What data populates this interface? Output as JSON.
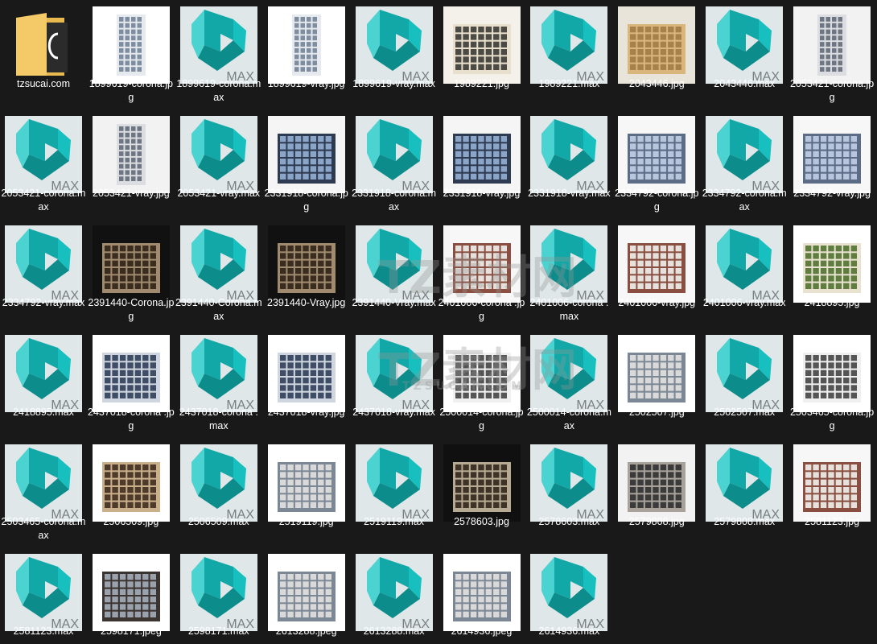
{
  "window": {
    "background": "#191919",
    "text_color": "#ffffff"
  },
  "icons": {
    "max": {
      "name": "3ds-max-file-icon",
      "badge": "MAX",
      "teal": "#11a8a7",
      "bg": "#dfe7e9"
    },
    "folder": {
      "name": "folder-icon",
      "color": "#f4c967"
    },
    "image": {
      "name": "image-thumbnail-icon"
    }
  },
  "watermark": {
    "main": "TZ素材网",
    "sub": "TZSUCAI.COM"
  },
  "files": [
    {
      "name": "tzsucai.com",
      "type": "folder"
    },
    {
      "name": "1899619-corona.jpg",
      "type": "image",
      "style": "white"
    },
    {
      "name": "1899619-corona.max",
      "type": "max"
    },
    {
      "name": "1899619-vray.jpg",
      "type": "image",
      "style": "white"
    },
    {
      "name": "1899619-vray.max",
      "type": "max"
    },
    {
      "name": "1989221.jpg",
      "type": "image",
      "style": "classic"
    },
    {
      "name": "1989221.max",
      "type": "max"
    },
    {
      "name": "2043446.jpg",
      "type": "image",
      "style": "tan"
    },
    {
      "name": "2043446.max",
      "type": "max"
    },
    {
      "name": "2053421-corona.jpg",
      "type": "image",
      "style": "tower"
    },
    {
      "name": "2053421-corona.max",
      "type": "max"
    },
    {
      "name": "2053421-vray.jpg",
      "type": "image",
      "style": "tower"
    },
    {
      "name": "2053421-vray.max",
      "type": "max"
    },
    {
      "name": "2331918-corona.jpg",
      "type": "image",
      "style": "dark"
    },
    {
      "name": "2331918-corona.max",
      "type": "max"
    },
    {
      "name": "2331918-vray.jpg",
      "type": "image",
      "style": "dark"
    },
    {
      "name": "2331918-vray.max",
      "type": "max"
    },
    {
      "name": "2334792-corona.jpg",
      "type": "image",
      "style": "glass"
    },
    {
      "name": "2334792-corona.max",
      "type": "max"
    },
    {
      "name": "2334792-vray.jpg",
      "type": "image",
      "style": "glass"
    },
    {
      "name": "2334792-vray.max",
      "type": "max"
    },
    {
      "name": "2391440-Corona.jpg",
      "type": "image",
      "style": "night"
    },
    {
      "name": "2391440-Corona.max",
      "type": "max"
    },
    {
      "name": "2391440-Vray.jpg",
      "type": "image",
      "style": "night"
    },
    {
      "name": "2391440-Vray.max",
      "type": "max"
    },
    {
      "name": "2401006-corona .jpg",
      "type": "image",
      "style": "brick"
    },
    {
      "name": "2401006-corona .max",
      "type": "max"
    },
    {
      "name": "2401006-vray.jpg",
      "type": "image",
      "style": "brick"
    },
    {
      "name": "2401006-vray.max",
      "type": "max"
    },
    {
      "name": "2418895.jpg",
      "type": "image",
      "style": "green"
    },
    {
      "name": "2418895.max",
      "type": "max"
    },
    {
      "name": "2437018-corona .jpg",
      "type": "image",
      "style": "modern"
    },
    {
      "name": "2437018-corona .max",
      "type": "max"
    },
    {
      "name": "2437018-vray.jpg",
      "type": "image",
      "style": "modern"
    },
    {
      "name": "2437018-vray.max",
      "type": "max"
    },
    {
      "name": "2500014-corona.jpg",
      "type": "image",
      "style": "stripes"
    },
    {
      "name": "2500014-corona.max",
      "type": "max"
    },
    {
      "name": "2502507.jpg",
      "type": "image",
      "style": "sheet"
    },
    {
      "name": "2502507.max",
      "type": "max"
    },
    {
      "name": "2503465-corona.jpg",
      "type": "image",
      "style": "stripes"
    },
    {
      "name": "2503465-corona.max",
      "type": "max"
    },
    {
      "name": "2506509.jpg",
      "type": "image",
      "style": "balcony"
    },
    {
      "name": "2506509.max",
      "type": "max"
    },
    {
      "name": "2519119.jpg",
      "type": "image",
      "style": "sheet"
    },
    {
      "name": "2519119.max",
      "type": "max"
    },
    {
      "name": "2578603.jpg",
      "type": "image",
      "style": "blackpanel"
    },
    {
      "name": "2578603.max",
      "type": "max"
    },
    {
      "name": "2579808.jpg",
      "type": "image",
      "style": "facade"
    },
    {
      "name": "2579808.max",
      "type": "max"
    },
    {
      "name": "2581123.jpg",
      "type": "image",
      "style": "brick"
    },
    {
      "name": "2581123.max",
      "type": "max"
    },
    {
      "name": "2598171.jpeg",
      "type": "image",
      "style": "darkblock"
    },
    {
      "name": "2598171.max",
      "type": "max"
    },
    {
      "name": "2613288.jpeg",
      "type": "image",
      "style": "sheet"
    },
    {
      "name": "2613288.max",
      "type": "max"
    },
    {
      "name": "2614936.jpeg",
      "type": "image",
      "style": "sheet"
    },
    {
      "name": "2614936.max",
      "type": "max"
    }
  ]
}
